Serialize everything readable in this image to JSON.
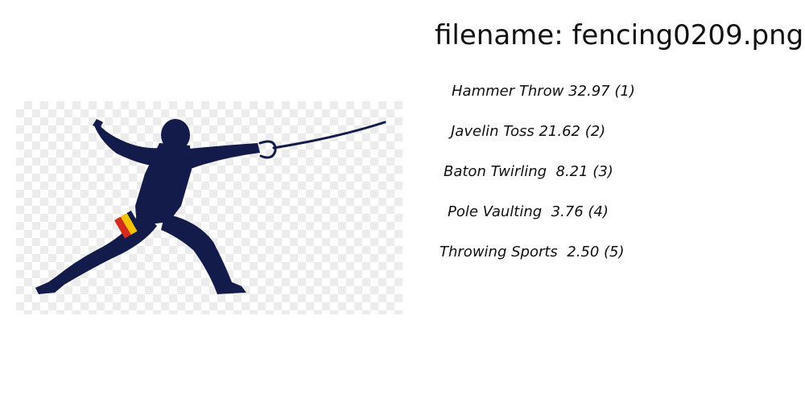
{
  "filename_text": "filename: fencing0209.png",
  "image": {
    "description_icon": "fencer-silhouette-icon",
    "silhouette_color": "#131b4a",
    "flag_colors": [
      "#d72a1f",
      "#f4c300",
      "#131b4a"
    ]
  },
  "labels": [
    {
      "text": "Hammer Throw 32.97 (1)"
    },
    {
      "text": "Javelin Toss 21.62 (2)"
    },
    {
      "text": "Baton Twirling  8.21 (3)"
    },
    {
      "text": "Pole Vaulting  3.76 (4)"
    },
    {
      "text": "Throwing Sports  2.50 (5)"
    }
  ]
}
